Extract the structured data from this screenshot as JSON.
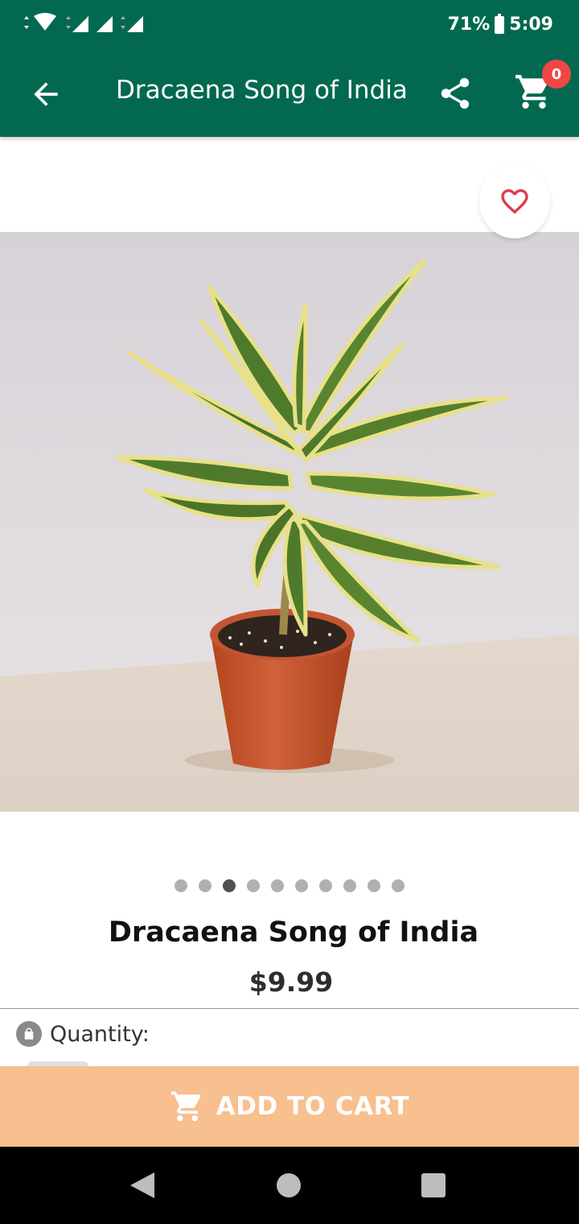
{
  "status_bar": {
    "battery": "71%",
    "time": "5:09"
  },
  "app_bar": {
    "title": "Dracaena Song of India",
    "cart_count": "0"
  },
  "product": {
    "name": "Dracaena Song of India",
    "price": "$9.99",
    "carousel": {
      "total": 10,
      "active_index": 2
    }
  },
  "quantity": {
    "label": "Quantity:"
  },
  "add_to_cart_label": "ADD TO CART",
  "colors": {
    "primary": "#026950",
    "badge": "#f04646",
    "cta": "#f8bf8f",
    "heart": "#e0394f"
  }
}
